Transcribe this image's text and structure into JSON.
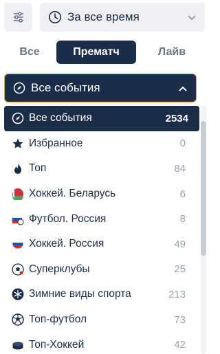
{
  "header": {
    "period_label": "За все время"
  },
  "tabs": {
    "all": "Все",
    "prematch": "Прематч",
    "live": "Лайв"
  },
  "events_dropdown": {
    "label": "Все события"
  },
  "list": [
    {
      "name": "Все события",
      "count": "2534",
      "icon": "compass-icon"
    },
    {
      "name": "Избранное",
      "count": "0",
      "icon": "star-icon"
    },
    {
      "name": "Топ",
      "count": "84",
      "icon": "flame-icon"
    },
    {
      "name": "Хоккей. Беларусь",
      "count": "6",
      "icon": "belarus-flag-icon"
    },
    {
      "name": "Футбол. Россия",
      "count": "8",
      "icon": "russia-football-icon"
    },
    {
      "name": "Хоккей. Россия",
      "count": "49",
      "icon": "russia-hockey-icon"
    },
    {
      "name": "Суперклубы",
      "count": "25",
      "icon": "soccer-ball-icon"
    },
    {
      "name": "Зимние виды спорта",
      "count": "213",
      "icon": "snowflake-icon"
    },
    {
      "name": "Топ-футбол",
      "count": "73",
      "icon": "football-icon"
    },
    {
      "name": "Топ-Хоккей",
      "count": "42",
      "icon": "hockey-puck-icon"
    }
  ],
  "colors": {
    "navy": "#1c2d4a",
    "accent_border": "#d7a44a",
    "muted": "#9aa3b0"
  }
}
